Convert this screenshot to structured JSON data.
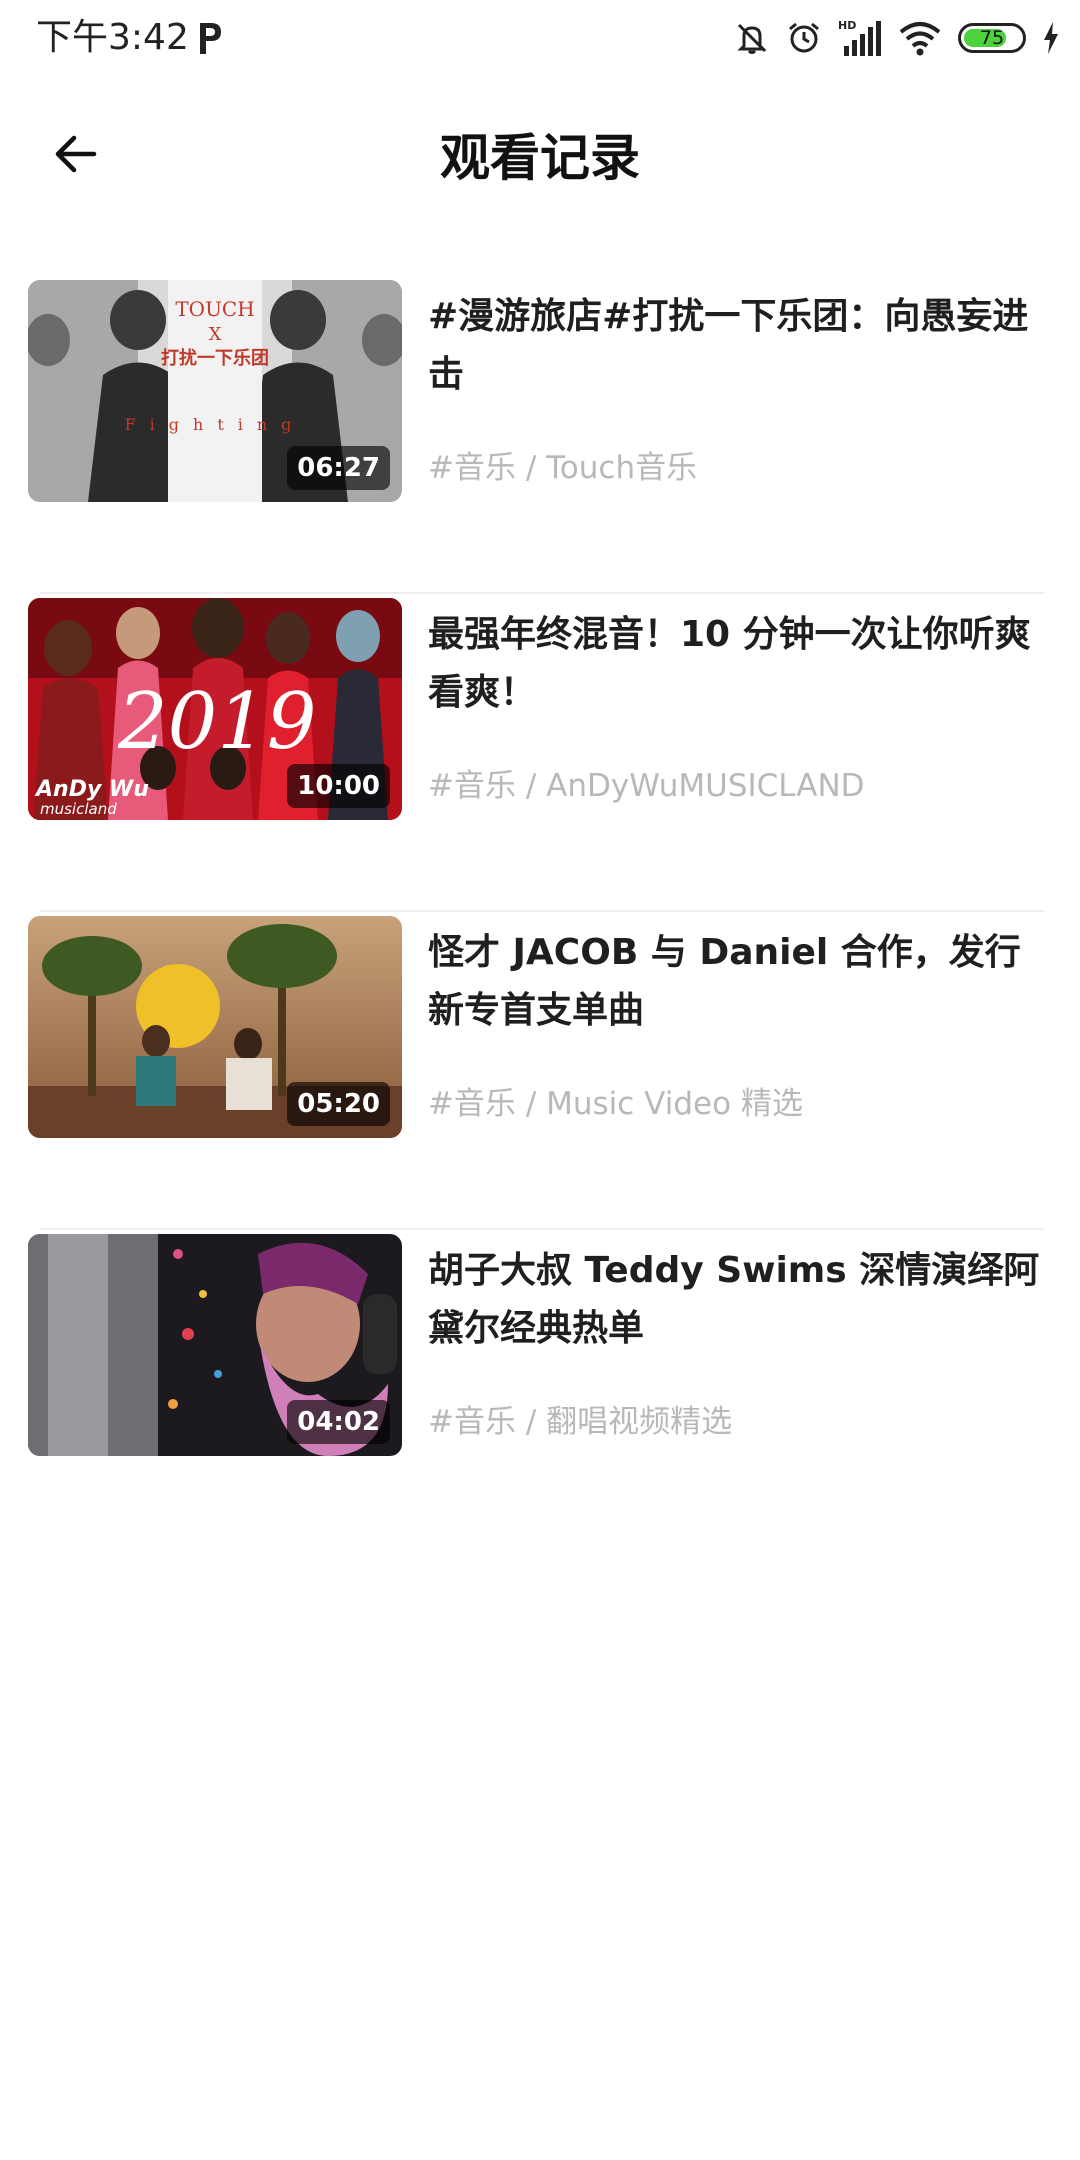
{
  "status_bar": {
    "time": "下午3:42",
    "battery": "75",
    "battery_level": 0.75,
    "battery_color": "#4cd23a",
    "icons": [
      "p-icon",
      "mute-icon",
      "alarm-icon",
      "hd-signal-icon",
      "wifi-icon",
      "battery-icon",
      "charging-icon"
    ]
  },
  "header": {
    "title": "观看记录",
    "back_icon": "arrow-left-icon"
  },
  "history": [
    {
      "title": "#漫游旅店#打扰一下乐团：向愚妄进击",
      "duration": "06:27",
      "meta": "#音乐 / Touch音乐",
      "thumb_text": [
        "TOUCH",
        "X",
        "打扰一下乐团",
        "Fighting"
      ]
    },
    {
      "title": "最强年终混音！10 分钟一次让你听爽看爽！",
      "duration": "10:00",
      "meta": "#音乐 / AnDyWuMUSICLAND",
      "thumb_text": [
        "2019",
        "AnDy Wu",
        "musicland"
      ]
    },
    {
      "title": "怪才 JACOB 与 Daniel 合作，发行新专首支单曲",
      "duration": "05:20",
      "meta": "#音乐 / Music Video 精选",
      "thumb_text": []
    },
    {
      "title": "胡子大叔 Teddy Swims 深情演绎阿黛尔经典热单",
      "duration": "04:02",
      "meta": "#音乐 / 翻唱视频精选",
      "thumb_text": []
    }
  ]
}
